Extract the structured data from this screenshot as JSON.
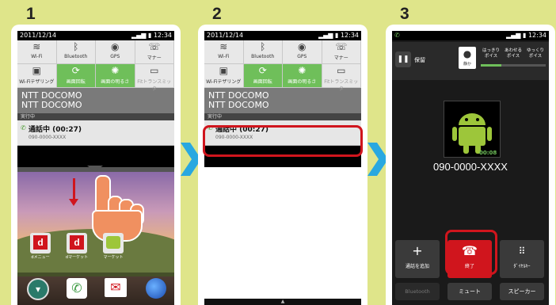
{
  "steps": [
    {
      "number": "1"
    },
    {
      "number": "2"
    },
    {
      "number": "3"
    }
  ],
  "status": {
    "date": "2011/12/14",
    "time": "12:34"
  },
  "quick_settings": [
    {
      "label": "Wi-Fi",
      "icon": "wifi-icon"
    },
    {
      "label": "Bluetooth",
      "icon": "bluetooth-icon"
    },
    {
      "label": "GPS",
      "icon": "gps-icon"
    },
    {
      "label": "マナー",
      "icon": "manner-icon"
    },
    {
      "label": "Wi-Fiテザリング",
      "icon": "wifi-tethering-icon"
    },
    {
      "label": "画面回転",
      "icon": "rotate-icon"
    },
    {
      "label": "画面の明るさ",
      "icon": "brightness-icon"
    },
    {
      "label": "Fitトランスミッタ",
      "icon": "fm-transmitter-icon"
    }
  ],
  "carrier_lines": [
    "NTT DOCOMO",
    "NTT DOCOMO"
  ],
  "running_label": "実行中",
  "notification": {
    "title": "通話中 (00:27)",
    "number": "090-0000-XXXX"
  },
  "home_apps": [
    "dメニュー",
    "dマーケット",
    "マーケット"
  ],
  "call": {
    "hold_label": "保留",
    "quiet_label": "静か",
    "voice_options": [
      "はっきり ボイス",
      "あわせる ボイス",
      "ゆっくり ボイス"
    ],
    "timer": "00:08",
    "number": "090-0000-XXXX",
    "add_call": "通話を追加",
    "end": "終了",
    "dialpad": "ﾀﾞｲﾔﾙｷｰ",
    "bluetooth": "Bluetooth",
    "mute": "ミュート",
    "speaker": "スピーカー"
  },
  "colors": {
    "background": "#dfe58a",
    "accent_arrow": "#29a8e0",
    "highlight": "#d0151d",
    "qs_on": "#6fbf5a",
    "android": "#9dc63a"
  }
}
